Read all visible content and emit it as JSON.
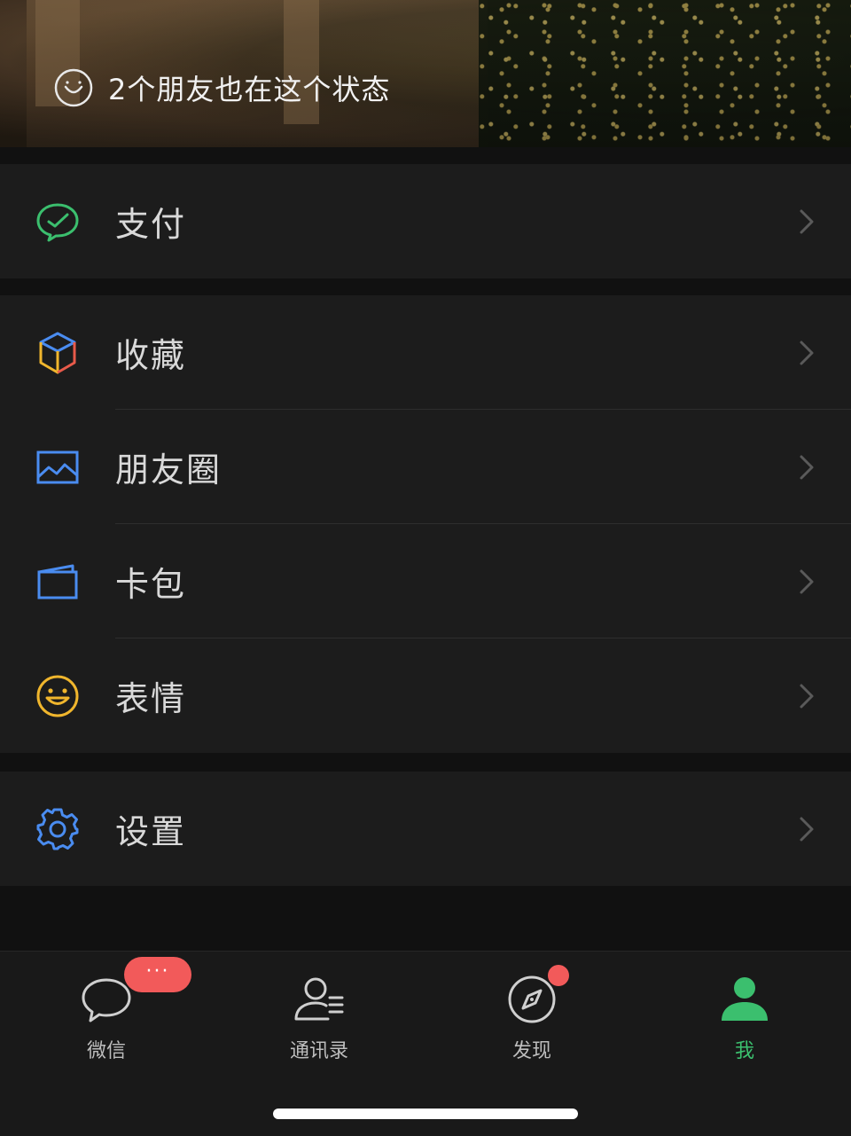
{
  "banner": {
    "status_text": "2个朋友也在这个状态",
    "status_icon": "smile-outline-icon"
  },
  "groups": [
    {
      "items": [
        {
          "label": "支付",
          "icon": "wechat-pay-icon",
          "color": "#3bbf6e"
        }
      ]
    },
    {
      "items": [
        {
          "label": "收藏",
          "icon": "favorites-cube-icon",
          "color": "#4a8cf0"
        },
        {
          "label": "朋友圈",
          "icon": "moments-picture-icon",
          "color": "#4a8cf0"
        },
        {
          "label": "卡包",
          "icon": "card-wallet-icon",
          "color": "#4a8cf0"
        },
        {
          "label": "表情",
          "icon": "sticker-smile-icon",
          "color": "#f0b62d"
        }
      ]
    },
    {
      "items": [
        {
          "label": "设置",
          "icon": "settings-gear-icon",
          "color": "#4a8cf0"
        }
      ]
    }
  ],
  "tabbar": {
    "tabs": [
      {
        "label": "微信",
        "icon": "chat-bubble-icon",
        "badge": "···"
      },
      {
        "label": "通讯录",
        "icon": "contacts-icon"
      },
      {
        "label": "发现",
        "icon": "discover-compass-icon",
        "dot": true
      },
      {
        "label": "我",
        "icon": "me-person-icon",
        "active": true
      }
    ]
  },
  "colors": {
    "accent": "#3bbf6e",
    "badge": "#f25a5a",
    "background": "#111111",
    "row_background": "#1c1c1c"
  }
}
